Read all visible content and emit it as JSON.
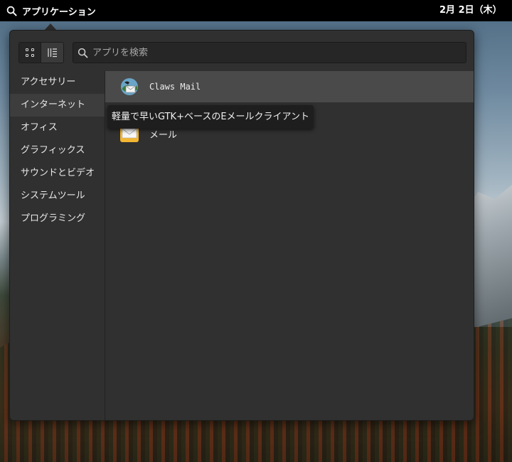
{
  "topbar": {
    "applications_label": "アプリケーション",
    "clock": "2月 2日（木）"
  },
  "search": {
    "placeholder": "アプリを検索",
    "value": ""
  },
  "categories": [
    {
      "label": "アクセサリー"
    },
    {
      "label": "インターネット"
    },
    {
      "label": "オフィス"
    },
    {
      "label": "グラフィックス"
    },
    {
      "label": "サウンドとビデオ"
    },
    {
      "label": "システムツール"
    },
    {
      "label": "プログラミング"
    }
  ],
  "selected_category": "インターネット",
  "apps": [
    {
      "name": "Claws Mail",
      "icon": "claws-mail-icon"
    },
    {
      "name": "メール",
      "icon": "mail-envelope-icon"
    }
  ],
  "tooltip": "軽量で早いGTK+ベースのEメールクライアント",
  "colors": {
    "panel_bg": "#303030",
    "selected_row": "#4a4a4a",
    "topbar_bg": "#000000"
  }
}
